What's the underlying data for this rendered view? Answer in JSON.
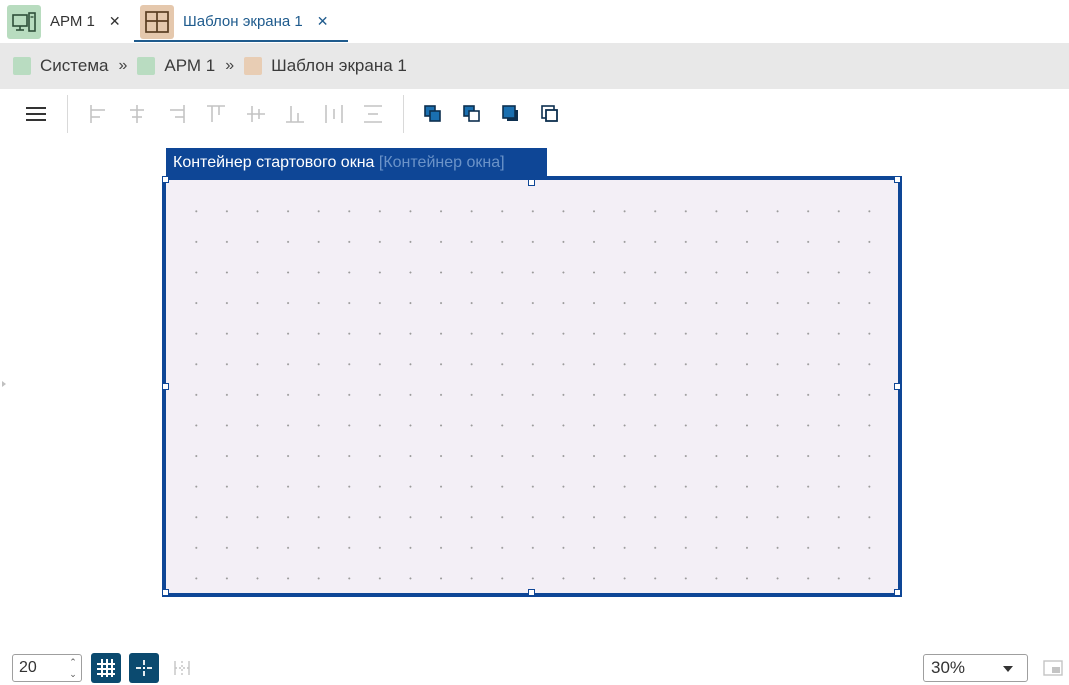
{
  "tabs": [
    {
      "label": "АРМ 1",
      "icon": "workstation-icon",
      "color": "#b8dcbf",
      "active": false
    },
    {
      "label": "Шаблон экрана 1",
      "icon": "screen-template-icon",
      "color": "#e5c8ad",
      "active": true
    }
  ],
  "breadcrumb": [
    {
      "label": "Система",
      "color": "#b9dcc1"
    },
    {
      "label": "АРМ 1",
      "color": "#b9dcc1"
    },
    {
      "label": "Шаблон экрана 1",
      "color": "#e8cdb4"
    }
  ],
  "breadcrumb_separator": "»",
  "toolbar": {
    "menu_icon": "hamburger-menu-icon",
    "align_buttons": [
      "align-left-icon",
      "align-center-horizontal-icon",
      "align-right-icon",
      "align-top-icon",
      "align-middle-vertical-icon",
      "align-bottom-icon",
      "distribute-horizontal-icon",
      "distribute-vertical-icon"
    ],
    "order_buttons": [
      "bring-forward-icon",
      "send-backward-icon",
      "bring-to-front-icon",
      "send-to-back-icon"
    ]
  },
  "canvas": {
    "container_name": "Контейнер стартового окна",
    "container_type": "[Контейнер окна]",
    "frame_color": "#0e4696",
    "fill_color": "#f3eff6"
  },
  "bottom": {
    "grid_size": "20",
    "zoom": "30%",
    "accent": "#0b4a6f"
  }
}
